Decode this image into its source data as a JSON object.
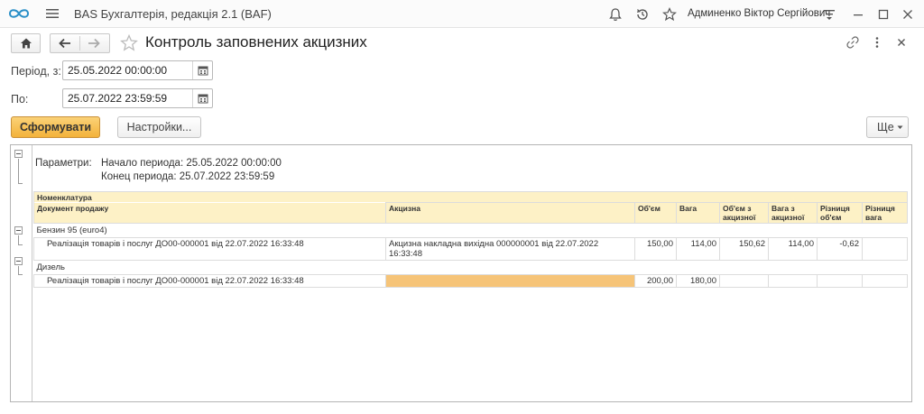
{
  "app": {
    "title": "BAS Бухгалтерія, редакція 2.1  (BAF)",
    "user": "Админенко Віктор Сергійович"
  },
  "form": {
    "title": "Контроль заповнених акцизних"
  },
  "period": {
    "from_label": "Період, з:",
    "from_value": "25.05.2022 00:00:00",
    "to_label": "По:",
    "to_value": "25.07.2022 23:59:59"
  },
  "toolbar": {
    "generate_label": "Сформувати",
    "settings_label": "Настройки...",
    "more_label": "Ще"
  },
  "report": {
    "params_label": "Параметри:",
    "params": [
      "Начало периода: 25.05.2022 00:00:00",
      "Конец периода: 25.07.2022 23:59:59"
    ],
    "header": {
      "group_col": "Номенклатура",
      "doc_col": "Документ продажу",
      "excise_col": "Акцизна",
      "volume_col": "Об'єм",
      "weight_col": "Вага",
      "volume_excise_col": "Об'єм з акцизної",
      "weight_excise_col": "Вага з акцизної",
      "diff_volume_col": "Різниця об'єм",
      "diff_weight_col": "Різниця вага"
    },
    "groups": [
      {
        "name": "Бензин 95 (euro4)",
        "rows": [
          {
            "doc": "Реалізація товарів і послуг ДО00-000001 від 22.07.2022 16:33:48",
            "excise": "Акцизна накладна вихідна 000000001 від 22.07.2022 16:33:48",
            "volume": "150,00",
            "weight": "114,00",
            "volume_excise": "150,62",
            "weight_excise": "114,00",
            "diff_volume": "-0,62",
            "diff_weight": ""
          }
        ]
      },
      {
        "name": "Дизель",
        "rows": [
          {
            "doc": "Реалізація товарів і послуг ДО00-000001 від 22.07.2022 16:33:48",
            "excise": "",
            "volume": "200,00",
            "weight": "180,00",
            "volume_excise": "",
            "weight_excise": "",
            "diff_volume": "",
            "diff_weight": ""
          }
        ]
      }
    ]
  },
  "colors": {
    "accent": "#f3b23a",
    "header_bg": "#fdf1c6",
    "missing_excise": "#f6c478"
  }
}
